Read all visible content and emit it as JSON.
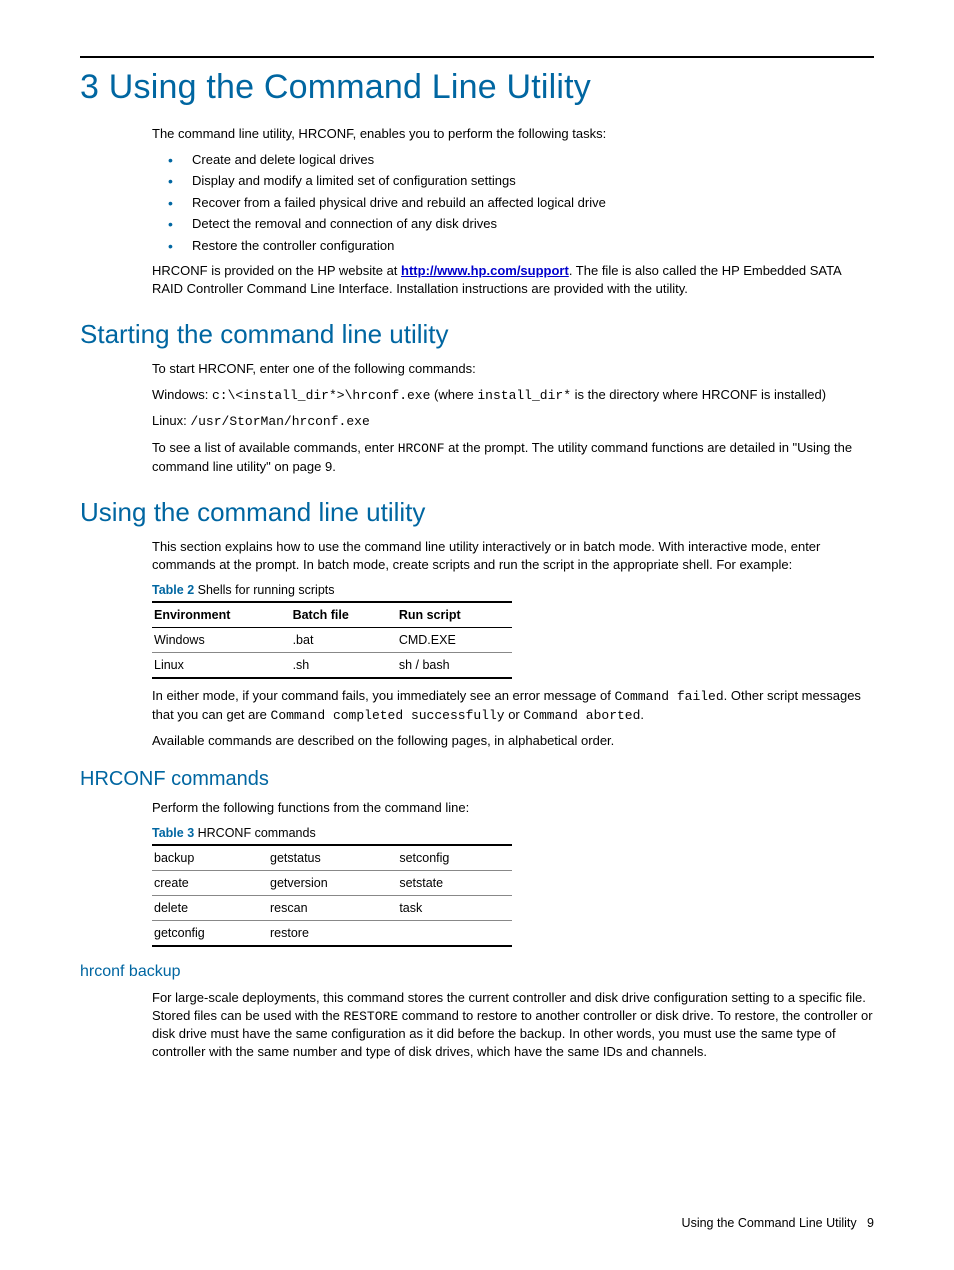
{
  "h1": "3 Using the Command Line Utility",
  "intro": "The command line utility, HRCONF, enables you to perform the following tasks:",
  "bullets": [
    "Create and delete logical drives",
    "Display and modify a limited set of configuration settings",
    "Recover from a failed physical drive and rebuild an affected logical drive",
    "Detect the removal and connection of any disk drives",
    "Restore the controller configuration"
  ],
  "after_bullets_pre": "HRCONF is provided on the HP website at ",
  "support_link": "http://www.hp.com/support",
  "after_bullets_post": ". The file is also called the HP Embedded SATA RAID Controller Command Line Interface. Installation instructions are provided with the utility.",
  "h2_start": "Starting the command line utility",
  "start_p1": "To start HRCONF, enter one of the following commands:",
  "start_win_label": "Windows: ",
  "start_win_cmd": "c:\\<install_dir*>\\hrconf.exe",
  "start_win_tail1": " (where ",
  "start_win_tail_mono": "install_dir*",
  "start_win_tail2": " is the directory where HRCONF is installed)",
  "start_lin_label": "Linux: ",
  "start_lin_cmd": "/usr/StorMan/hrconf.exe",
  "start_p3a": "To see a list of available commands, enter ",
  "start_p3_mono": "HRCONF",
  "start_p3b": " at the prompt. The utility command functions are detailed in \"Using the command line utility\" on page 9.",
  "h2_use": "Using the command line utility",
  "use_p1": "This section explains how to use the command line utility interactively or in batch mode. With interactive mode, enter commands at the prompt. In batch mode, create scripts and run the script in the appropriate shell. For example:",
  "table2_caption_label": "Table 2",
  "table2_caption_text": "  Shells for running scripts",
  "table2_headers": [
    "Environment",
    "Batch file",
    "Run script"
  ],
  "table2_rows": [
    [
      "Windows",
      ".bat",
      "CMD.EXE"
    ],
    [
      "Linux",
      ".sh",
      "sh / bash"
    ]
  ],
  "use_p2a": "In either mode, if your command fails, you immediately see an error message of ",
  "use_p2_m1": "Command failed",
  "use_p2b": ". Other script messages that you can get are ",
  "use_p2_m2": "Command completed successfully",
  "use_p2c": " or ",
  "use_p2_m3": "Command aborted",
  "use_p2d": ".",
  "use_p3": "Available commands are described on the following pages, in alphabetical order.",
  "h3_cmds": "HRCONF commands",
  "cmds_p1": "Perform the following functions from the command line:",
  "table3_caption_label": "Table 3",
  "table3_caption_text": "  HRCONF commands",
  "table3_rows": [
    [
      "backup",
      "getstatus",
      "setconfig"
    ],
    [
      "create",
      "getversion",
      "setstate"
    ],
    [
      "delete",
      "rescan",
      "task"
    ],
    [
      "getconfig",
      "restore",
      ""
    ]
  ],
  "h4_backup": "hrconf backup",
  "backup_p1a": "For large-scale deployments, this command stores the current controller and disk drive configuration setting to a specific file. Stored files can be used with the ",
  "backup_p1_m": "RESTORE",
  "backup_p1b": " command to restore to another controller or disk drive. To restore, the controller or disk drive must have the same configuration as it did before the backup. In other words, you must use the same type of controller with the same number and type of disk drives, which have the same IDs and channels.",
  "footer_text": "Using the Command Line Utility",
  "footer_page": "9"
}
